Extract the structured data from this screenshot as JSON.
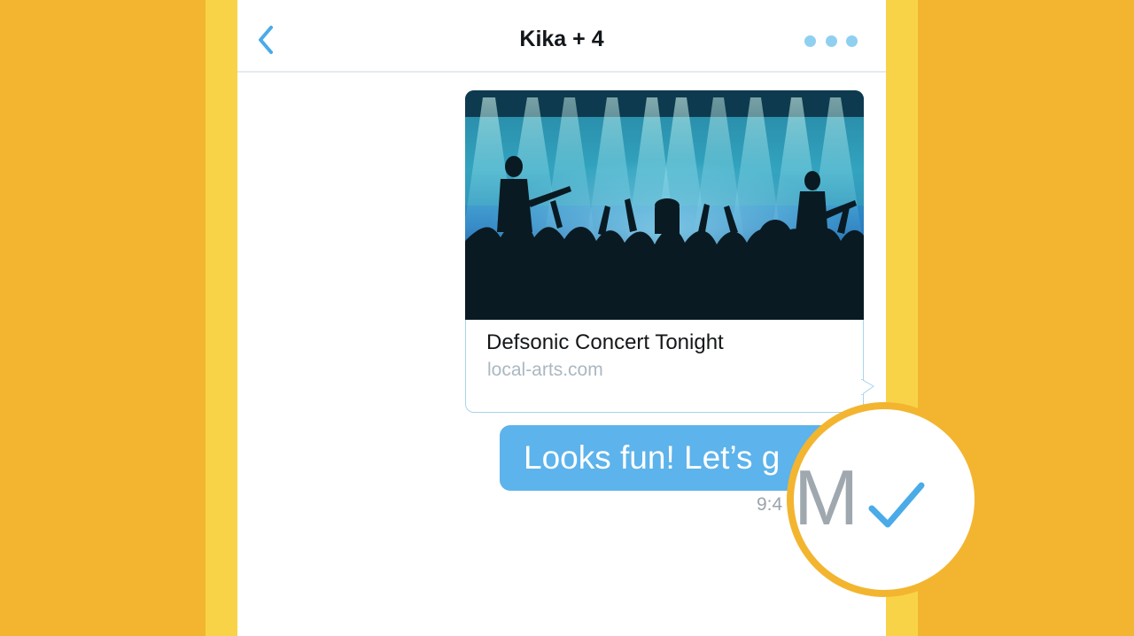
{
  "conversation": {
    "title": "Kika + 4"
  },
  "icons": {
    "back": "chevron-left-icon",
    "more": "more-dots-icon",
    "read_receipt": "checkmark-icon"
  },
  "link_card": {
    "title": "Defsonic Concert Tonight",
    "domain": "local-arts.com",
    "image": "concert-crowd-photo"
  },
  "message": {
    "text": "Looks fun! Let’s g",
    "time": "9:4"
  },
  "zoom_overlay": {
    "fragment": "M"
  },
  "colors": {
    "background": "#F3B52F",
    "side_band": "#F8D347",
    "accent_blue": "#4AABE8",
    "bubble": "#5DB3EB"
  }
}
